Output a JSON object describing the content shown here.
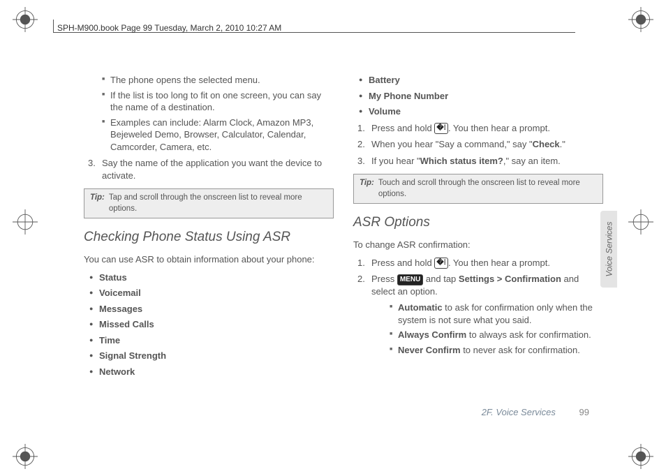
{
  "header": {
    "runhead": "SPH-M900.book  Page 99  Tuesday, March 2, 2010  10:27 AM"
  },
  "left": {
    "sub1": "The phone opens the selected menu.",
    "sub2": "If the list is too long to fit on one screen, you can say the name of a destination.",
    "sub3": "Examples can include: Alarm Clock, Amazon MP3, Bejeweled Demo, Browser, Calculator, Calendar, Camcorder, Camera, etc.",
    "step3": "Say the name of the application you want the device to activate.",
    "tip_label": "Tip:",
    "tip_text": "Tap and scroll through the onscreen list to reveal more options.",
    "h_check": "Checking Phone Status Using ASR",
    "intro": "You can use ASR to obtain information about your phone:",
    "items": [
      "Status",
      "Voicemail",
      "Messages",
      "Missed Calls",
      "Time",
      "Signal Strength",
      "Network"
    ]
  },
  "right": {
    "items_top": [
      "Battery",
      "My Phone Number",
      "Volume"
    ],
    "step1a": "Press and hold ",
    "step1b": ". You then hear a prompt.",
    "step2a": "When you hear \"Say a command,\" say \"",
    "step2b": "Check",
    "step2c": ".\"",
    "step3a": "If you hear \"",
    "step3b": "Which status item?",
    "step3c": ",\" say an item.",
    "tip_label": "Tip:",
    "tip_text": "Touch and scroll through the onscreen list to reveal more options.",
    "h_asr": "ASR Options",
    "intro": "To change ASR confirmation:",
    "o_step1a": "Press and hold ",
    "o_step1b": ". You then hear a prompt.",
    "o_step2a": "Press ",
    "o_step2b": " and tap ",
    "o_step2c": "Settings > Confirmation",
    "o_step2d": " and select an option.",
    "opt1a": "Automatic",
    "opt1b": " to ask for confirmation only when the system is not sure what you said.",
    "opt2a": "Always Confirm",
    "opt2b": " to always ask for confirmation.",
    "opt3a": "Never Confirm",
    "opt3b": " to never ask for confirmation.",
    "menu_key": "MENU"
  },
  "footer": {
    "section": "2F. Voice Services",
    "page": "99"
  },
  "sidetab": "Voice Services"
}
